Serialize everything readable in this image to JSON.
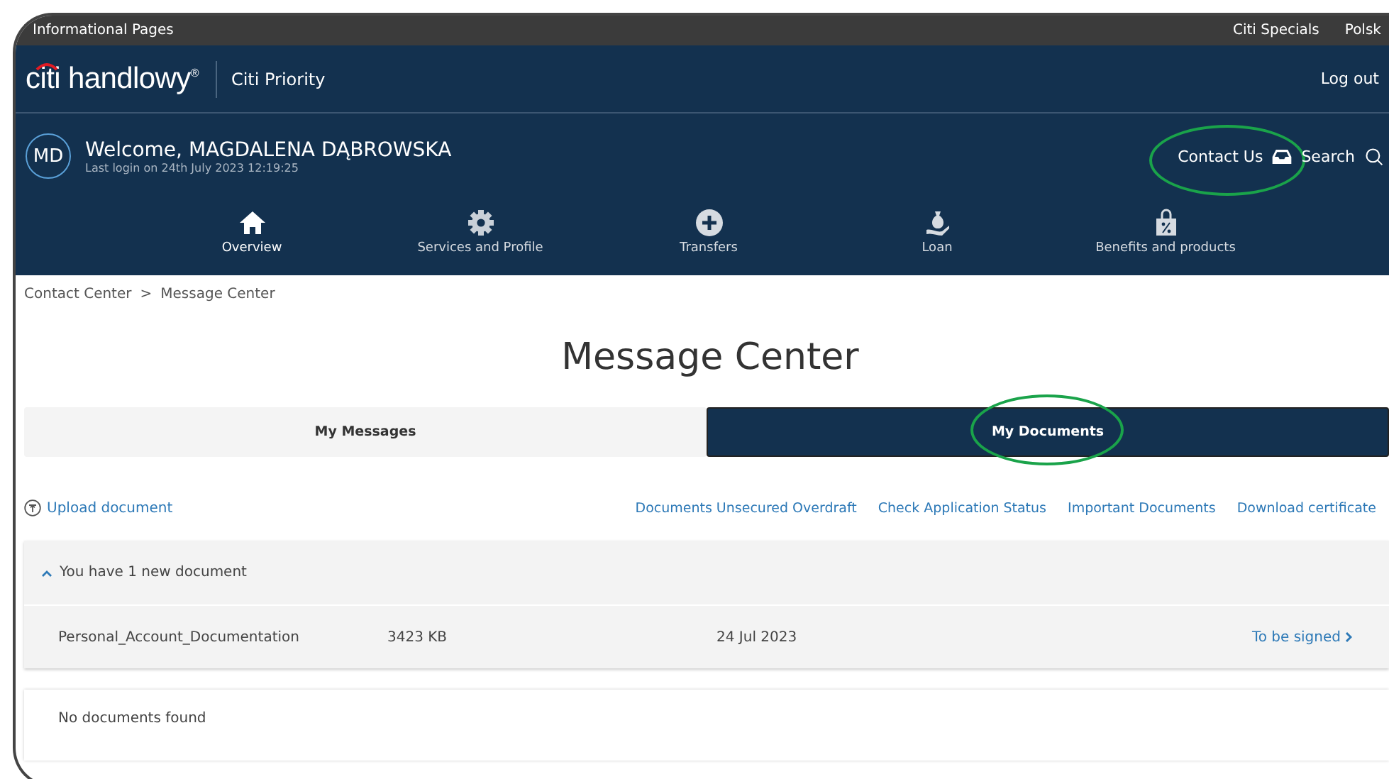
{
  "top_bar": {
    "left_link": "Informational Pages",
    "right_links": [
      "Citi Specials",
      "Polsk"
    ]
  },
  "header": {
    "logo": "citi handlowy$^{®}$",
    "product": "Citi Priority",
    "logout": "Log out"
  },
  "user": {
    "initials": "MD",
    "welcome": "Welcome, MAGDALENA DĄBROWSKA",
    "last_login": "Last login on 24th July 2023 12:19:25"
  },
  "actions": [
    {
      "kind": "contact",
      "label": "Contact Us",
      "highlighted": true
    },
    {
      "kind": "search",
      "label": "Search",
      "highlighted": false
    }
  ],
  "nav": [
    {
      "kind": "home",
      "label": "Overview"
    },
    {
      "kind": "gear",
      "label": "Services and Profile"
    },
    {
      "kind": "plus",
      "label": "Transfers"
    },
    {
      "kind": "loan",
      "label": "Loan"
    },
    {
      "kind": "bag",
      "label": "Benefits and products"
    }
  ],
  "breadcrumb": [
    "Contact Center",
    "Message Center"
  ],
  "breadcrumb_separator": ">",
  "title": "Message Center",
  "tabs": [
    {
      "label": "My Messages",
      "selected": false,
      "highlighted": false
    },
    {
      "label": "My Documents",
      "selected": true,
      "highlighted": true
    }
  ],
  "upload": "Upload document",
  "links": [
    "Documents Unsecured Overdraft",
    "Check Application Status",
    "Important Documents",
    "Download certificate"
  ],
  "new_documents": {
    "summary": "You have 1 new document",
    "expanded": true,
    "rows": [
      {
        "name": "Personal_Account_Documentation",
        "size": "3423 KB",
        "date": "24 Jul 2023",
        "action": "To be signed"
      }
    ]
  },
  "empty_message": "No documents found"
}
